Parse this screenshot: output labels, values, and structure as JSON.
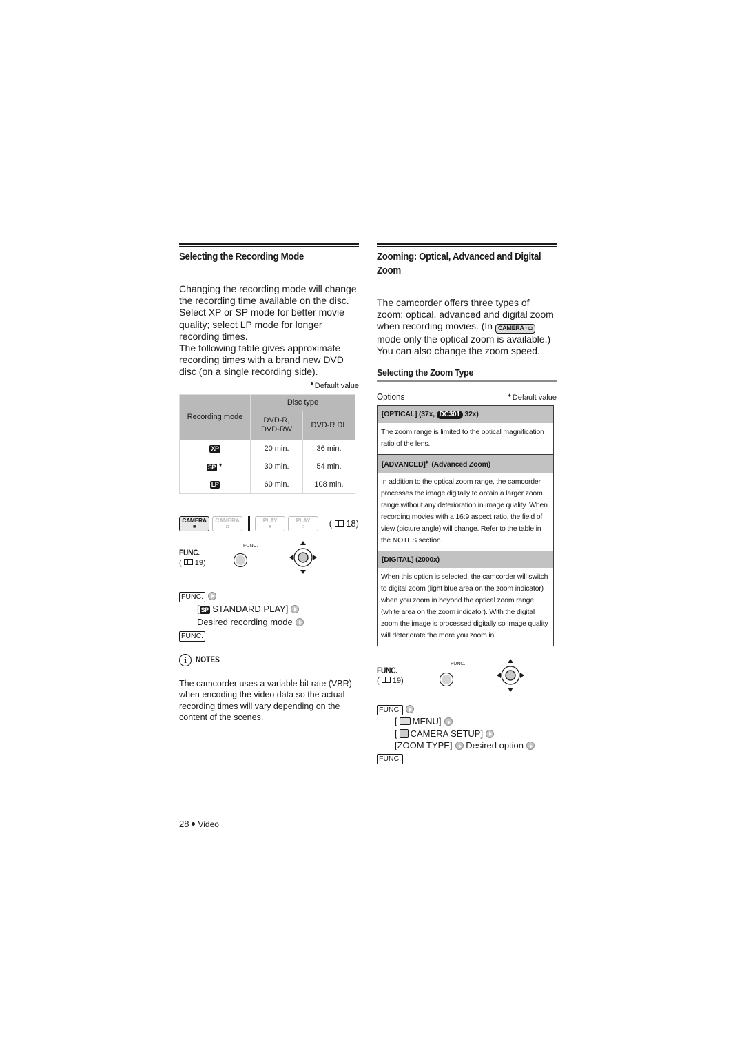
{
  "left": {
    "title": "Selecting the Recording Mode",
    "paragraph1": "Changing the recording mode will change the recording time available on the disc. Select XP or SP mode for better movie quality; select LP mode for longer recording times.",
    "paragraph2": "The following table gives approximate recording times with a brand new DVD disc (on a single recording side).",
    "default_note": "Default value",
    "table": {
      "col_mode": "Recording mode",
      "col_group": "Disc type",
      "col_dvdr": "DVD-R, DVD-RW",
      "col_dvdrdl": "DVD-R DL",
      "rows": [
        {
          "mode": "XP",
          "default": "",
          "dvdr": "20 min.",
          "dvdrdl": "36 min."
        },
        {
          "mode": "SP",
          "default": "♦",
          "dvdr": "30 min.",
          "dvdrdl": "54 min."
        },
        {
          "mode": "LP",
          "default": "",
          "dvdr": "60 min.",
          "dvdrdl": "108 min."
        }
      ]
    },
    "mode_chips": [
      {
        "top": "CAMERA",
        "sub": "movie",
        "active": true
      },
      {
        "top": "CAMERA",
        "sub": "photo",
        "active": false
      },
      {
        "top": "PLAY",
        "sub": "movie",
        "active": false
      },
      {
        "top": "PLAY",
        "sub": "photo",
        "active": false
      }
    ],
    "mode_ref": "18",
    "func_label": "FUNC.",
    "func_ref": "19",
    "func_btn_caption": "FUNC.",
    "procedure": {
      "func_key": "FUNC.",
      "step1": "STANDARD PLAY]",
      "step1_open": "[",
      "step2": "Desired recording mode"
    },
    "notes_title": "NOTES",
    "notes_text": "The camcorder uses a variable bit rate (VBR) when encoding the video data so the actual recording times will vary depending on the content of the scenes."
  },
  "right": {
    "title": "Zooming: Optical, Advanced and Digital Zoom",
    "para_a": "The camcorder offers three types of zoom: optical, advanced and digital zoom when recording movies. (In",
    "camera_chip": "CAMERA ·",
    "para_b": "mode only the optical zoom is available.) You can also change the zoom speed.",
    "subsection": "Selecting the Zoom Type",
    "options_label": "Options",
    "default_note": "Default value",
    "options": [
      {
        "head_a": "[OPTICAL] (37x,",
        "badge": "DC301",
        "head_b": "32x)",
        "body": "The zoom range is limited to the optical magnification ratio of the lens."
      },
      {
        "head_a": "[ADVANCED]",
        "default": "♦",
        "head_b": "(Advanced Zoom)",
        "body": "In addition to the optical zoom range, the camcorder processes the image digitally to obtain a larger zoom range without any deterioration in image quality. When recording movies with a 16:9 aspect ratio, the field of view (picture angle) will change. Refer to the table in the NOTES section."
      },
      {
        "head_a": "[DIGITAL] (2000x)",
        "body": "When this option is selected, the camcorder will switch to digital zoom (light blue area on the zoom indicator) when you zoom in beyond the optical zoom range (white area on the zoom indicator). With the digital zoom the image is processed digitally so image quality will deteriorate the more you zoom in."
      }
    ],
    "func_label": "FUNC.",
    "func_ref": "19",
    "func_btn_caption": "FUNC.",
    "procedure": {
      "func_key": "FUNC.",
      "menu": "MENU]",
      "camera_setup": "CAMERA SETUP]",
      "zoom_type": "[ZOOM TYPE]",
      "desired": "Desired option"
    }
  },
  "footer": {
    "page": "28",
    "section": "Video"
  }
}
